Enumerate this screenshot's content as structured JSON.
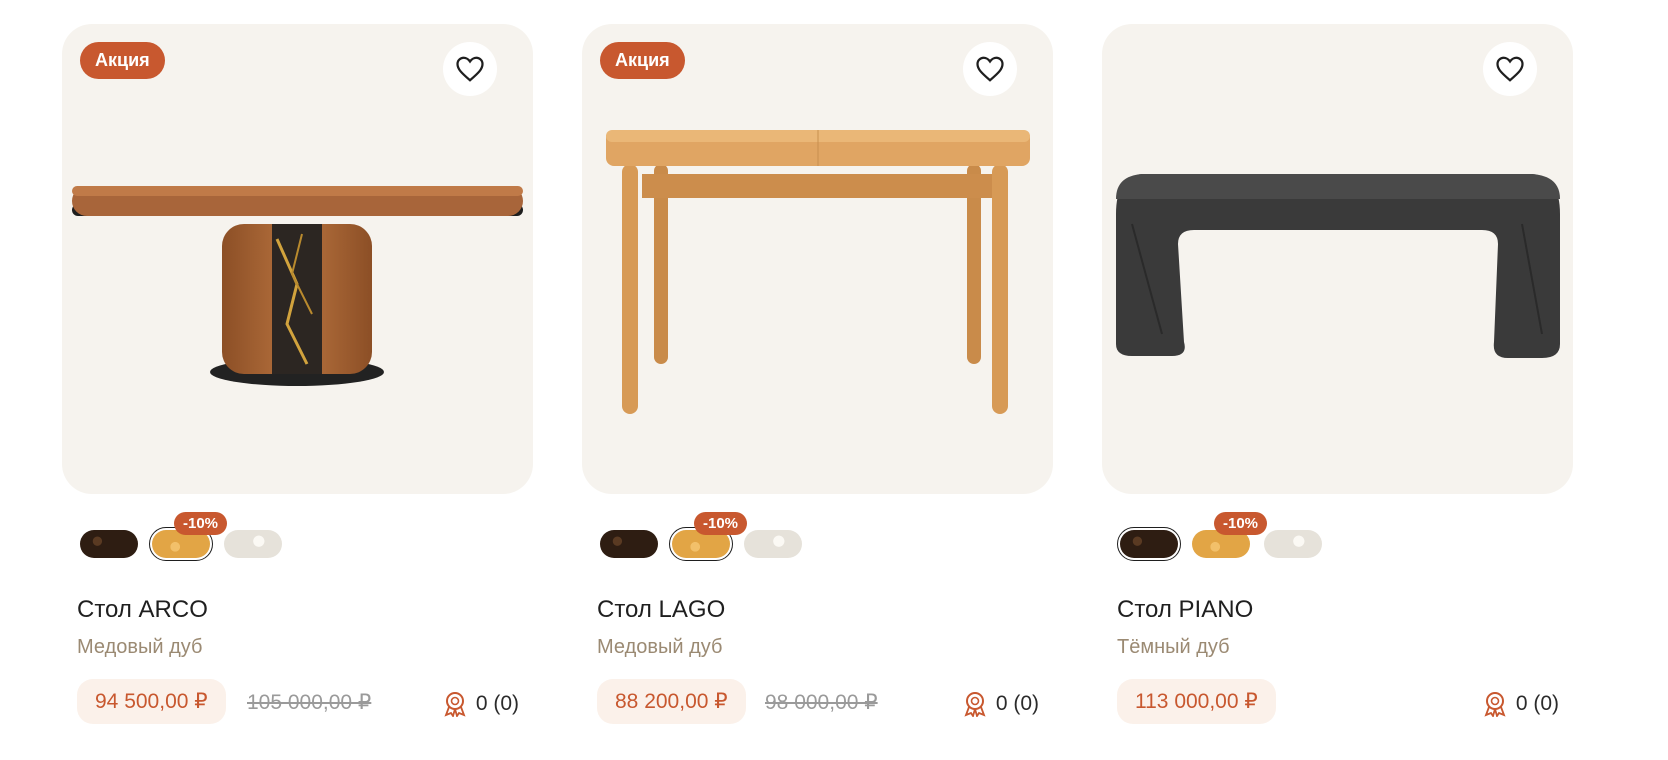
{
  "products": [
    {
      "sale_badge": "Акция",
      "discount_badge": "-10%",
      "title": "Стол ARCO",
      "subtitle": "Медовый дуб",
      "price": "94 500,00 ₽",
      "old_price": "105 000,00 ₽",
      "rating": "0 (0)"
    },
    {
      "sale_badge": "Акция",
      "discount_badge": "-10%",
      "title": "Стол LAGO",
      "subtitle": "Медовый дуб",
      "price": "88 200,00 ₽",
      "old_price": "98 000,00 ₽",
      "rating": "0 (0)"
    },
    {
      "discount_badge": "-10%",
      "title": "Стол PIANO",
      "subtitle": "Тёмный дуб",
      "price": "113 000,00 ₽",
      "rating": "0 (0)"
    }
  ],
  "colors": {
    "accent": "#c8582f",
    "card_bg": "#f6f3ee",
    "subtitle": "#9b8a73"
  },
  "icons": [
    "heart-icon",
    "award-icon"
  ]
}
